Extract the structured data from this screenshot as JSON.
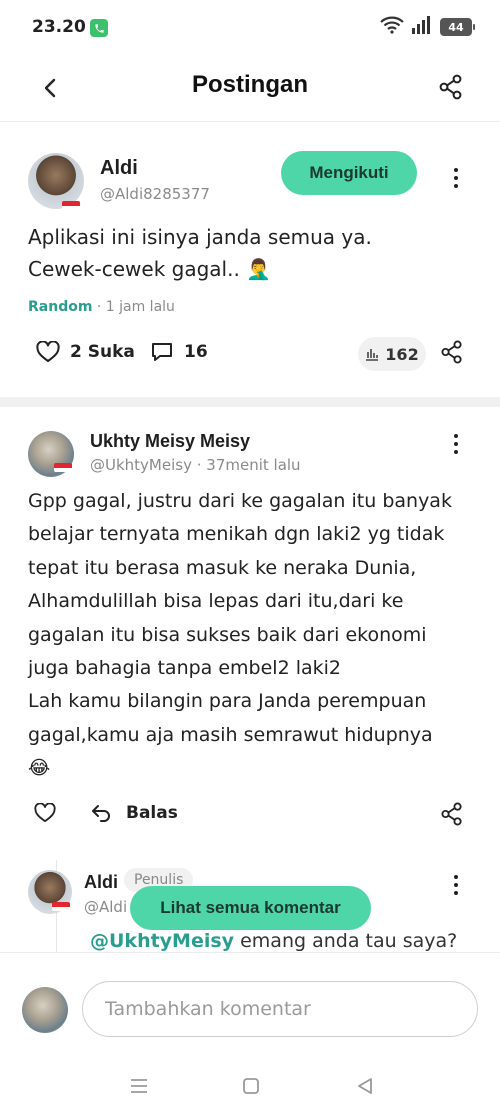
{
  "status_bar": {
    "time": "23.20",
    "battery": "44"
  },
  "header": {
    "title": "Postingan"
  },
  "post": {
    "author_name": "Aldi",
    "author_handle": "@Aldi8285377",
    "follow_label": "Mengikuti",
    "body_line1": "Aplikasi ini isinya janda semua ya.",
    "body_line2": "Cewek-cewek gagal.. 🤦‍♂️",
    "category": "Random",
    "time": " · 1 jam lalu",
    "likes_label": "2 Suka",
    "comments_count": "16",
    "views": "162"
  },
  "comment": {
    "author_name": "Ukhty Meisy Meisy",
    "author_handle": "@UkhtyMeisy",
    "time": " · 37menit lalu",
    "lines": [
      "Gpp gagal, justru dari ke gagalan itu banyak",
      "belajar ternyata menikah dgn laki2 yg tidak",
      "tepat itu berasa masuk ke neraka Dunia,",
      "Alhamdulillah bisa lepas dari itu,dari ke",
      "gagalan itu bisa sukses baik dari ekonomi",
      "juga bahagia tanpa embel2 laki2",
      "Lah kamu bilangin para Janda perempuan",
      "gagal,kamu aja masih semrawut hidupnya",
      "😂"
    ],
    "reply_label": "Balas"
  },
  "reply": {
    "author_name": "Aldi",
    "badge": "Penulis",
    "author_handle": "@Aldi",
    "mention": "@UkhtyMeisy",
    "text": " emang anda tau saya?"
  },
  "see_all_label": "Lihat semua komentar",
  "composer": {
    "placeholder": "Tambahkan komentar"
  },
  "colors": {
    "accent": "#4fd6a8",
    "link": "#2a9d8f"
  }
}
